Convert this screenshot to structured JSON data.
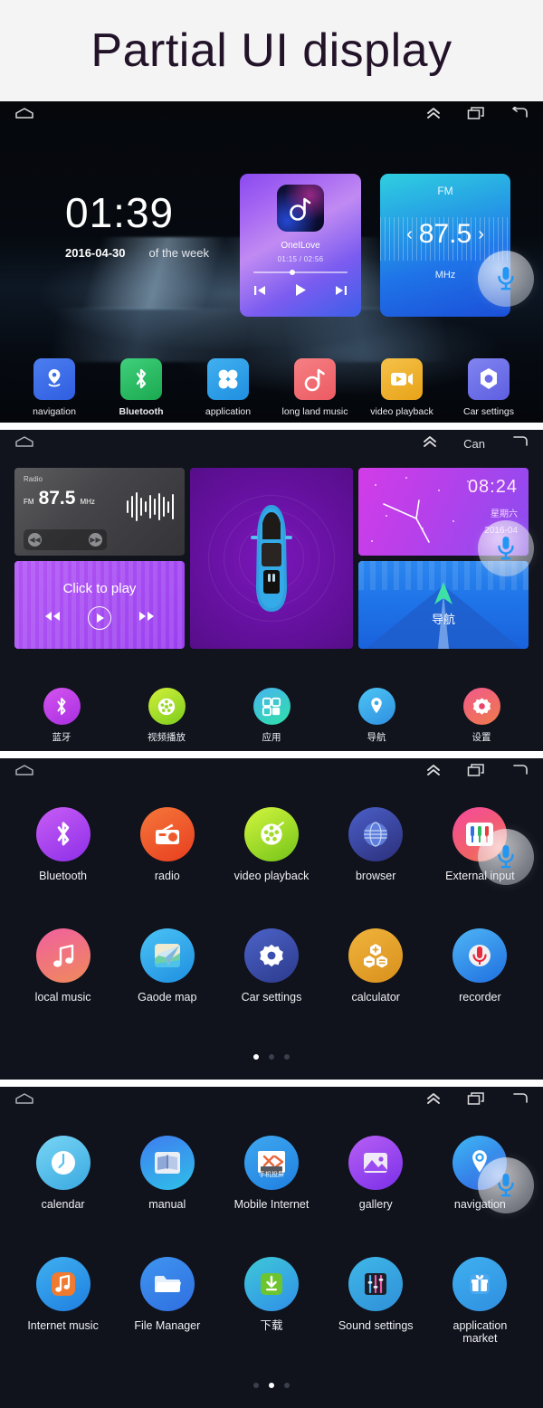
{
  "page": {
    "title": "Partial UI display"
  },
  "statusbar": {
    "home_icon": "home-icon",
    "expand_icon": "double-chevron-up-icon",
    "recents_icon": "recent-apps-icon",
    "back_icon": "back-arrow-icon",
    "can_label": "Can",
    "mic_icon": "microphone-icon"
  },
  "screen1": {
    "clock": {
      "time": "01:39",
      "date": "2016-04-30",
      "weekday": "of the week"
    },
    "music_widget": {
      "title": "OneILove",
      "elapsed": "01:15",
      "separator": "/",
      "duration": "02:56",
      "prev_icon": "previous-track-icon",
      "play_icon": "play-icon",
      "next_icon": "next-track-icon"
    },
    "fm_widget": {
      "band": "FM",
      "frequency": "87.5",
      "unit": "MHz",
      "prev_icon": "chevron-left-icon",
      "next_icon": "chevron-right-icon"
    },
    "dock": [
      {
        "label": "navigation",
        "icon": "map-pin-icon",
        "color": "#3b6ee8"
      },
      {
        "label": "Bluetooth",
        "icon": "bluetooth-icon",
        "color": "#2bbd63",
        "bold": true
      },
      {
        "label": "application",
        "icon": "apps-grid-icon",
        "color": "#2e9fe8"
      },
      {
        "label": "long land music",
        "icon": "music-note-icon",
        "color": "#f06e72"
      },
      {
        "label": "video playback",
        "icon": "video-camera-icon",
        "color": "#f0b425"
      },
      {
        "label": "Car settings",
        "icon": "car-settings-icon",
        "color": "#6e6ce8"
      }
    ]
  },
  "screen2": {
    "radio_widget": {
      "name": "Radio",
      "band": "FM",
      "frequency": "87.5",
      "unit": "MHz",
      "prev_icon": "rewind-icon",
      "next_icon": "fast-forward-icon"
    },
    "player_widget": {
      "label": "Click to play",
      "prev_icon": "rewind-icon",
      "play_icon": "play-circle-icon",
      "next_icon": "fast-forward-icon"
    },
    "car_widget": {
      "icon": "car-top-view-icon"
    },
    "clock_widget": {
      "time": "08:24",
      "weekday": "星期六",
      "date": "2016-04"
    },
    "nav_widget": {
      "label": "导航",
      "icon": "navigation-arrow-icon"
    },
    "dock": [
      {
        "label": "蓝牙",
        "icon": "bluetooth-icon",
        "color": "#c13ce0"
      },
      {
        "label": "视频播放",
        "icon": "film-reel-icon",
        "color": "#9ad82c"
      },
      {
        "label": "应用",
        "icon": "apps-grid-icon",
        "color": "#35d39b"
      },
      {
        "label": "导航",
        "icon": "map-pin-icon",
        "color": "#33a9ea"
      },
      {
        "label": "设置",
        "icon": "gear-icon",
        "color": "#e8456d"
      }
    ]
  },
  "screen3": {
    "apps": [
      {
        "label": "Bluetooth",
        "icon": "bluetooth-icon",
        "color": "#b043ef"
      },
      {
        "label": "radio",
        "icon": "radio-icon",
        "color": "#ef5a2a"
      },
      {
        "label": "video playback",
        "icon": "film-reel-icon",
        "color": "#a3dc2e"
      },
      {
        "label": "browser",
        "icon": "globe-icon",
        "color": "#3b4ea8"
      },
      {
        "label": "External input",
        "icon": "aux-plugs-icon",
        "color": "#ef4590"
      },
      {
        "label": "local music",
        "icon": "music-note-icon",
        "color": "#ef5f8c"
      },
      {
        "label": "Gaode map",
        "icon": "map-paperplane-icon",
        "color": "#2fb3ef"
      },
      {
        "label": "Car settings",
        "icon": "gear-icon",
        "color": "#3a4fb0"
      },
      {
        "label": "calculator",
        "icon": "calculator-icon",
        "color": "#e8a12b"
      },
      {
        "label": "recorder",
        "icon": "microphone-icon",
        "color": "#2f8fe8"
      }
    ],
    "page_dots": {
      "count": 3,
      "active": 0
    }
  },
  "screen4": {
    "apps": [
      {
        "label": "calendar",
        "icon": "clock-icon",
        "color": "#56c3ef"
      },
      {
        "label": "manual",
        "icon": "book-icon",
        "color": "#2f7fe8"
      },
      {
        "label": "Mobile Internet",
        "icon": "screen-mirroring-icon",
        "color": "#2f8fe8",
        "badge": "手机投屏"
      },
      {
        "label": "gallery",
        "icon": "photo-icon",
        "color": "#9b4cf0"
      },
      {
        "label": "navigation",
        "icon": "map-pin-icon",
        "color": "#2f9ff0"
      },
      {
        "label": "Internet music",
        "icon": "music-note-icon",
        "color": "#2f9fef"
      },
      {
        "label": "File Manager",
        "icon": "folder-icon",
        "color": "#2f85ef"
      },
      {
        "label": "下载",
        "icon": "download-icon",
        "color": "#3fc8a8"
      },
      {
        "label": "Sound settings",
        "icon": "sliders-icon",
        "color": "#2fa8e8"
      },
      {
        "label": "application market",
        "icon": "gift-box-icon",
        "color": "#2f9fe8"
      }
    ],
    "page_dots": {
      "count": 3,
      "active": 1
    }
  }
}
